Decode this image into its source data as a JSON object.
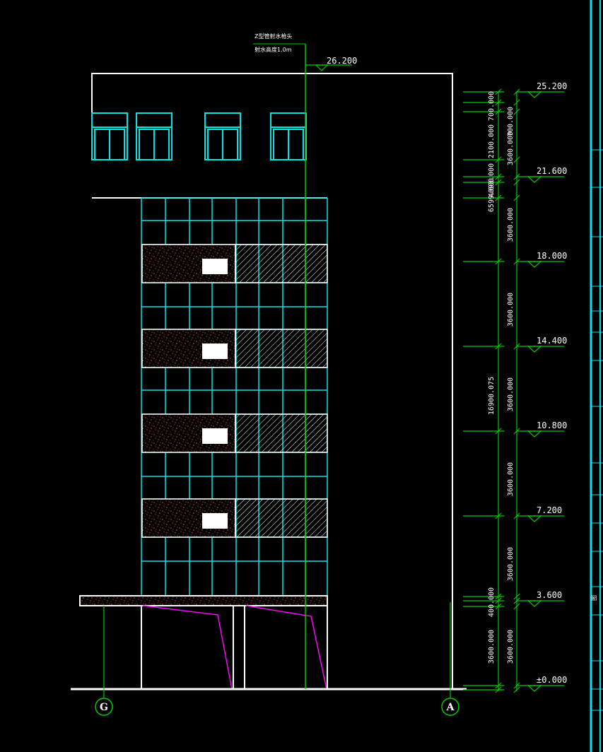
{
  "colors": {
    "background": "#000000",
    "outline": "#ffffff",
    "glazing": "#00e5e5",
    "level_line": "#00cc00",
    "spandrel_fill": "#ff5a1a",
    "canopy_stroke": "#ff00ff"
  },
  "annotations": {
    "riser_note_line1": "Z型管射水枪头",
    "riser_note_line2": "射水高度1.0m"
  },
  "levels": [
    {
      "id": "top-of-parapet",
      "label": "26.200"
    },
    {
      "id": "roof",
      "label": "25.200"
    },
    {
      "id": "floor-7",
      "label": "21.600"
    },
    {
      "id": "floor-6",
      "label": "18.000"
    },
    {
      "id": "floor-5",
      "label": "14.400"
    },
    {
      "id": "floor-4",
      "label": "10.800"
    },
    {
      "id": "floor-3",
      "label": "7.200"
    },
    {
      "id": "floor-2",
      "label": "3.600"
    },
    {
      "id": "ground",
      "label": "±0.000"
    }
  ],
  "dimensions": {
    "top_a": "700.000",
    "top_b": "700.000",
    "upper_2100": "2100.000",
    "upper_3600": "3600.000",
    "small_4093": "4093.000",
    "small_6599": "6599.000",
    "storey_6": "3600.000",
    "storey_5": "3600.000",
    "storey_4": "3600.000",
    "storey_3": "3600.000",
    "storey_2": "3600.000",
    "storey_1": "3600.000",
    "canopy_400": "400.000",
    "total_overall": "16900.075",
    "ground_outer": "3600.000"
  },
  "axes": {
    "left": "G",
    "right": "A"
  }
}
